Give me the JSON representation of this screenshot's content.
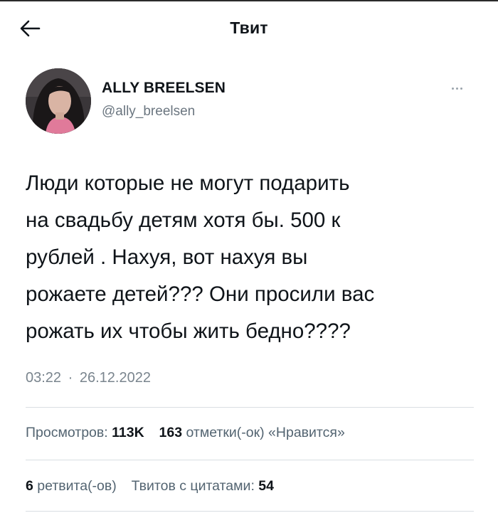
{
  "header": {
    "title": "Твит",
    "back_icon": "arrow-left-icon"
  },
  "author": {
    "name": "ALLY BREELSEN",
    "handle": "@ally_breelsen"
  },
  "tweet": {
    "lines": [
      "Люди которые не могут подарить",
      "на свадьбу детям хотя бы. 500 к",
      "рублей . Нахуя, вот нахуя вы",
      "рожаете детей??? Они просили вас",
      "рожать их чтобы жить бедно????"
    ],
    "time": "03:22",
    "separator": "·",
    "date": "26.12.2022"
  },
  "stats": {
    "views_label": "Просмотров:",
    "views_count": "113K",
    "likes_count": "163",
    "likes_label": "отметки(-ок) «Нравится»",
    "retweets_count": "6",
    "retweets_label": "ретвита(-ов)",
    "quotes_label": "Твитов с цитатами:",
    "quotes_count": "54"
  },
  "colors": {
    "text": "#0f1419",
    "secondary": "#536471",
    "divider": "#d9dee2"
  }
}
